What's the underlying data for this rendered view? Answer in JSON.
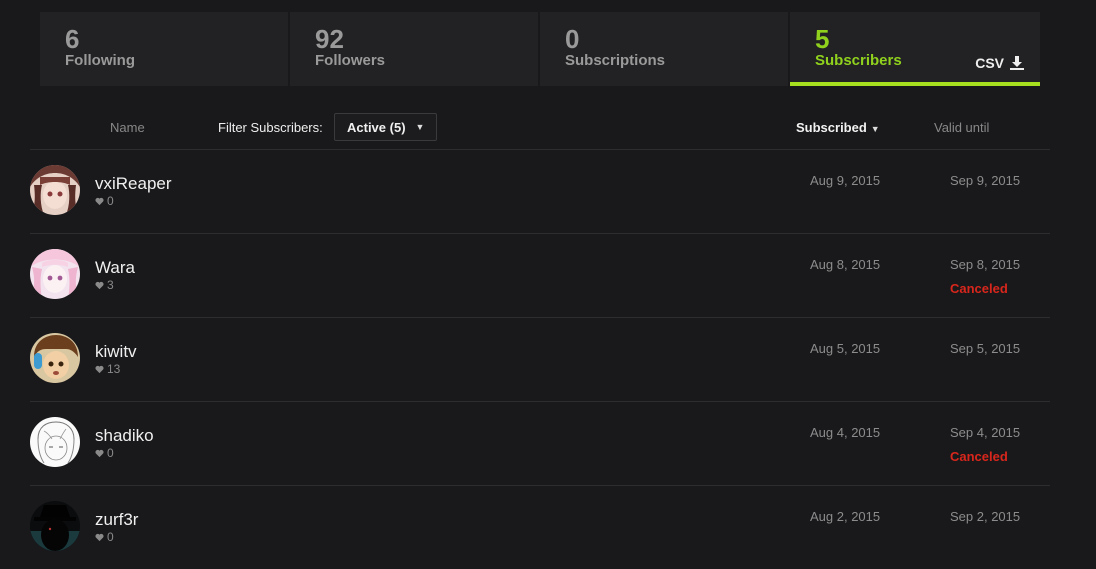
{
  "tabs": [
    {
      "count": "6",
      "label": "Following"
    },
    {
      "count": "92",
      "label": "Followers"
    },
    {
      "count": "0",
      "label": "Subscriptions"
    },
    {
      "count": "5",
      "label": "Subscribers"
    }
  ],
  "csv_label": "CSV",
  "header": {
    "name": "Name",
    "filter_label": "Filter Subscribers:",
    "filter_value": "Active (5)",
    "subscribed": "Subscribed",
    "valid_until": "Valid until"
  },
  "colors": {
    "accent": "#a7e01e",
    "canceled": "#d9261c"
  },
  "subscribers": [
    {
      "name": "vxiReaper",
      "likes": "0",
      "subscribed": "Aug 9, 2015",
      "valid_until": "Sep 9, 2015",
      "status": ""
    },
    {
      "name": "Wara",
      "likes": "3",
      "subscribed": "Aug 8, 2015",
      "valid_until": "Sep 8, 2015",
      "status": "Canceled"
    },
    {
      "name": "kiwitv",
      "likes": "13",
      "subscribed": "Aug 5, 2015",
      "valid_until": "Sep 5, 2015",
      "status": ""
    },
    {
      "name": "shadiko",
      "likes": "0",
      "subscribed": "Aug 4, 2015",
      "valid_until": "Sep 4, 2015",
      "status": "Canceled"
    },
    {
      "name": "zurf3r",
      "likes": "0",
      "subscribed": "Aug 2, 2015",
      "valid_until": "Sep 2, 2015",
      "status": ""
    }
  ]
}
